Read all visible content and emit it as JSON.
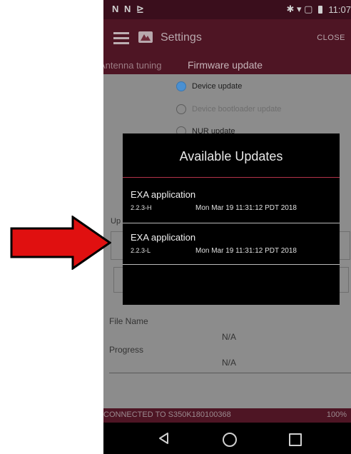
{
  "status_bar": {
    "left_icons": "N N ⊵",
    "right_icons": "✱ ▾ ▢",
    "time": "11:07"
  },
  "toolbar": {
    "title": "Settings",
    "close_label": "CLOSE",
    "menu_icon": "hamburger-icon",
    "logo_icon": "app-logo-icon"
  },
  "tabs": [
    {
      "label": "Antenna tuning"
    },
    {
      "label": "Firmware update"
    }
  ],
  "update_type": {
    "options": [
      {
        "label": "Device update",
        "checked": true
      },
      {
        "label": "Device bootloader update",
        "checked": false
      },
      {
        "label": "NUR update",
        "checked": false
      }
    ]
  },
  "hidden_label": "Up",
  "file": {
    "name_label": "File Name",
    "name_value": "N/A",
    "progress_label": "Progress",
    "progress_value": "N/A"
  },
  "dialog": {
    "title": "Available Updates",
    "items": [
      {
        "name": "EXA application",
        "version": "2.2.3-H",
        "date": "Mon Mar 19 11:31:12 PDT 2018"
      },
      {
        "name": "EXA application",
        "version": "2.2.3-L",
        "date": "Mon Mar 19 11:31:12 PDT 2018"
      }
    ]
  },
  "connection": {
    "text": "CONNECTED TO S350K180100368",
    "percent": "100%"
  },
  "colors": {
    "brand": "#4e1524",
    "accent": "#b3334a",
    "arrow": "#e01010"
  }
}
